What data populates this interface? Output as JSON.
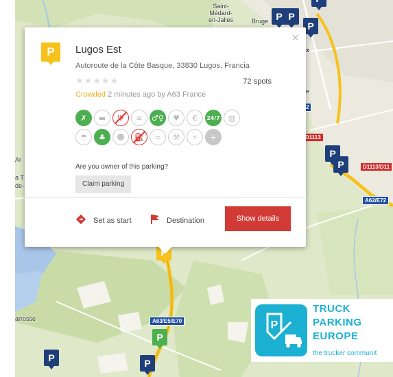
{
  "map": {
    "labels": {
      "saint_medard": "Saint-\nMédard-\nen-Jalles",
      "bruges": "Bruge",
      "x_label": "x",
      "e_label": "e",
      "ar_label": "Ar",
      "la_t_label": "a T",
      "de_label": "de-",
      "arrosse": "arrosse"
    },
    "roads": {
      "d1113_a": "D1113",
      "d1113_b": "D1113/D11",
      "a62_e72": "A62/E72",
      "a63_e5_e70": "A63/E5/E70",
      "small_shield": "2"
    },
    "markers": {
      "parking_letter": "P"
    }
  },
  "popup": {
    "close_glyph": "×",
    "icon_letter": "P",
    "title": "Lugos Est",
    "address": "Autoroute de la Côte Basque, 33830 Lugos, Francia",
    "stars": "★★★★★",
    "spots": "72 spots",
    "status": "Crowded",
    "status_rest": " 2 minutes ago by A63 France",
    "amenities_row1": [
      {
        "name": "no-parking-fee-icon",
        "glyph": "✗",
        "state": "on"
      },
      {
        "name": "bed-icon",
        "glyph": "▬",
        "state": "off"
      },
      {
        "name": "restaurant-icon",
        "glyph": "Ψ",
        "state": "no"
      },
      {
        "name": "wifi-icon",
        "glyph": "≋",
        "state": "off"
      },
      {
        "name": "toilet-icon",
        "glyph": "♂♀",
        "state": "on"
      },
      {
        "name": "heart-icon",
        "glyph": "♥",
        "state": "off"
      },
      {
        "name": "euro-icon",
        "glyph": "€",
        "state": "off"
      },
      {
        "name": "open-24-7-icon",
        "glyph": "24/7",
        "state": "on"
      },
      {
        "name": "fence-icon",
        "glyph": "▥",
        "state": "off"
      }
    ],
    "amenities_row2": [
      {
        "name": "shower-icon",
        "glyph": "☂",
        "state": "off"
      },
      {
        "name": "tree-icon",
        "glyph": "♣",
        "state": "on"
      },
      {
        "name": "security-icon",
        "glyph": "☻",
        "state": "off"
      },
      {
        "name": "fuel-icon",
        "glyph": "⛽",
        "state": "no"
      },
      {
        "name": "truck-wash-icon",
        "glyph": "≈",
        "state": "off"
      },
      {
        "name": "tools-icon",
        "glyph": "⚒",
        "state": "off"
      },
      {
        "name": "electric-icon",
        "glyph": "⚡",
        "state": "off"
      },
      {
        "name": "add-icon",
        "glyph": "+",
        "state": "grey"
      }
    ],
    "owner_question": "Are you owner of this parking?",
    "claim_label": "Claim parking",
    "set_start_label": "Set as start",
    "destination_label": "Destination",
    "show_details_label": "Show details"
  },
  "brand": {
    "line1": "TRUCK",
    "line2": "PARKING",
    "line3": "EUROPE",
    "tagline": "the trucker communit",
    "logo_letter": "P"
  },
  "colors": {
    "accent_red": "#d23b35",
    "green": "#4caf50",
    "yellow": "#f6c21b",
    "brand_blue": "#1cb1d2",
    "marker_blue": "#1f3f7a"
  }
}
